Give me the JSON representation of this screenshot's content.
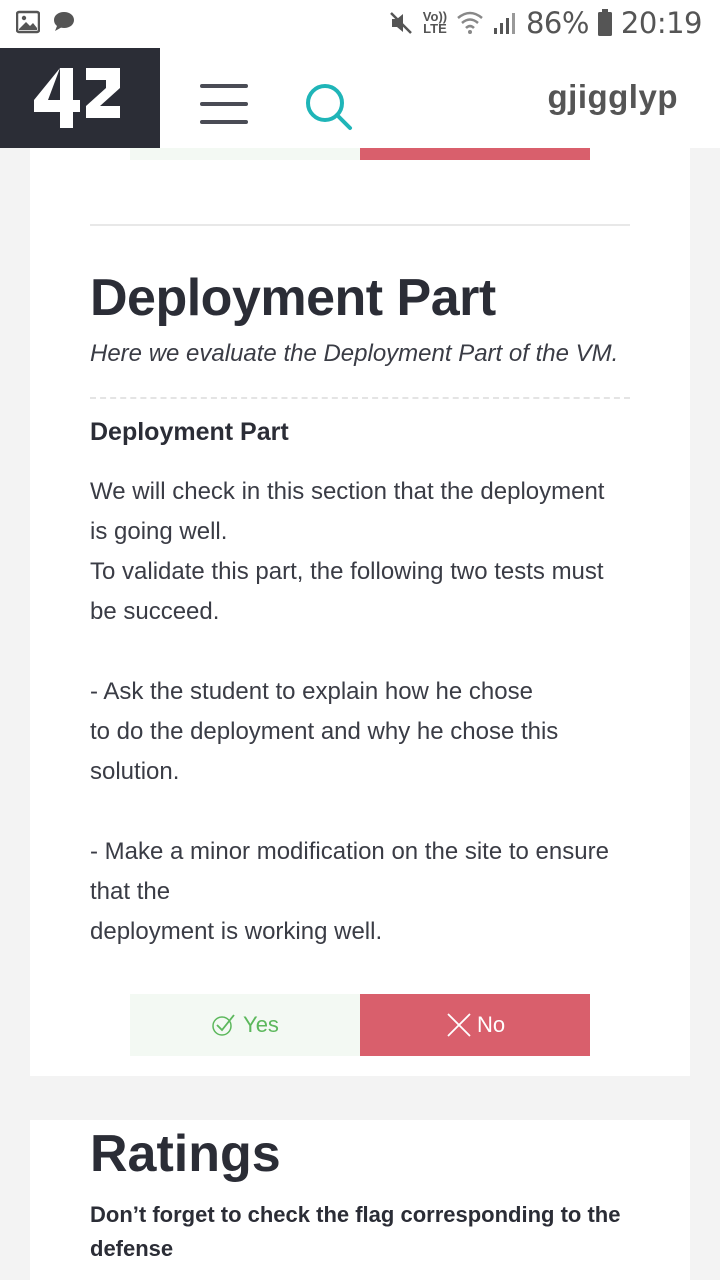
{
  "status_bar": {
    "network": "Vo)) LTE",
    "battery": "86%",
    "time": "20:19"
  },
  "header": {
    "logo": "42",
    "username": "gjigglyp"
  },
  "section": {
    "title": "Deployment Part",
    "subtitle": "Here we evaluate the Deployment Part of the VM.",
    "question": {
      "title": "Deployment Part",
      "lines": [
        "We will check in this section that the deployment",
        "is going well.",
        "To validate this part, the following two tests must",
        "be succeed.",
        "",
        "- Ask the student to explain how he chose",
        "to do the deployment and why he chose this",
        "solution.",
        "",
        "- Make a minor modification on the site to ensure",
        "that the",
        "deployment is working well."
      ]
    },
    "yes_label": "Yes",
    "no_label": "No"
  },
  "ratings": {
    "title": "Ratings",
    "note": "Don’t forget to check the flag corresponding to the defense"
  },
  "colors": {
    "dark": "#2b2d36",
    "accent": "#1fb5b8",
    "no": "#d95f6c",
    "yes": "#5cb85c"
  }
}
